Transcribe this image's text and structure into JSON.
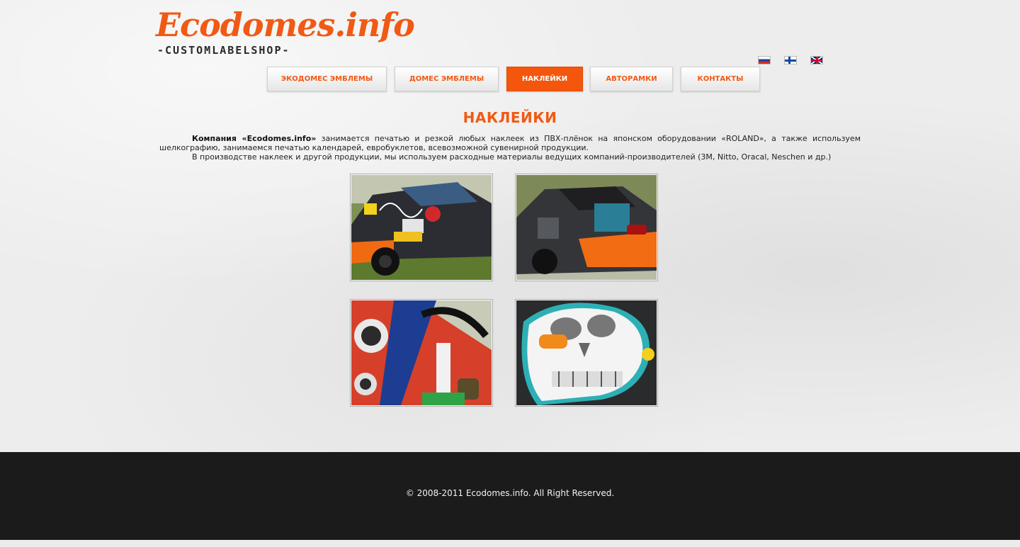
{
  "logo": {
    "name": "Ecodomes.info",
    "tagline": "-CUSTOMLABELSHOP-"
  },
  "languages": [
    {
      "code": "ru",
      "icon": "russia-flag-icon"
    },
    {
      "code": "fi",
      "icon": "finland-flag-icon"
    },
    {
      "code": "en",
      "icon": "uk-flag-icon"
    }
  ],
  "nav": {
    "items": [
      {
        "label": "ЭКОДОМЕС ЭМБЛЕМЫ",
        "active": false
      },
      {
        "label": "ДОМЕС ЭМБЛЕМЫ",
        "active": false
      },
      {
        "label": "НАКЛЕЙКИ",
        "active": true
      },
      {
        "label": "АВТОРАМКИ",
        "active": false
      },
      {
        "label": "КОНТАКТЫ",
        "active": false
      }
    ]
  },
  "page": {
    "title": "НАКЛЕЙКИ",
    "intro_company": "Компания «Ecodomes.info»",
    "intro_rest": " занимается печатью и резкой любых наклеек из ПВХ-плёнок на японском оборудовании «ROLAND», а также используем шелкографию, занимаемся печатью календарей, евробуклетов, всевозможной сувенирной продукции.",
    "intro_second": "В производстве наклеек и другой продукции, мы используем расходные материалы ведущих компаний-производителей (3M, Nitto, Oracal, Neschen и др.)"
  },
  "gallery": [
    {
      "icon": "car-graffiti-stickers-photo"
    },
    {
      "icon": "car-rear-stickers-photo"
    },
    {
      "icon": "car-yokohama-stickers-photo"
    },
    {
      "icon": "skull-sticker-photo"
    }
  ],
  "footer": {
    "copyright": "© 2008-2011 Ecodomes.info. All Right Reserved."
  }
}
